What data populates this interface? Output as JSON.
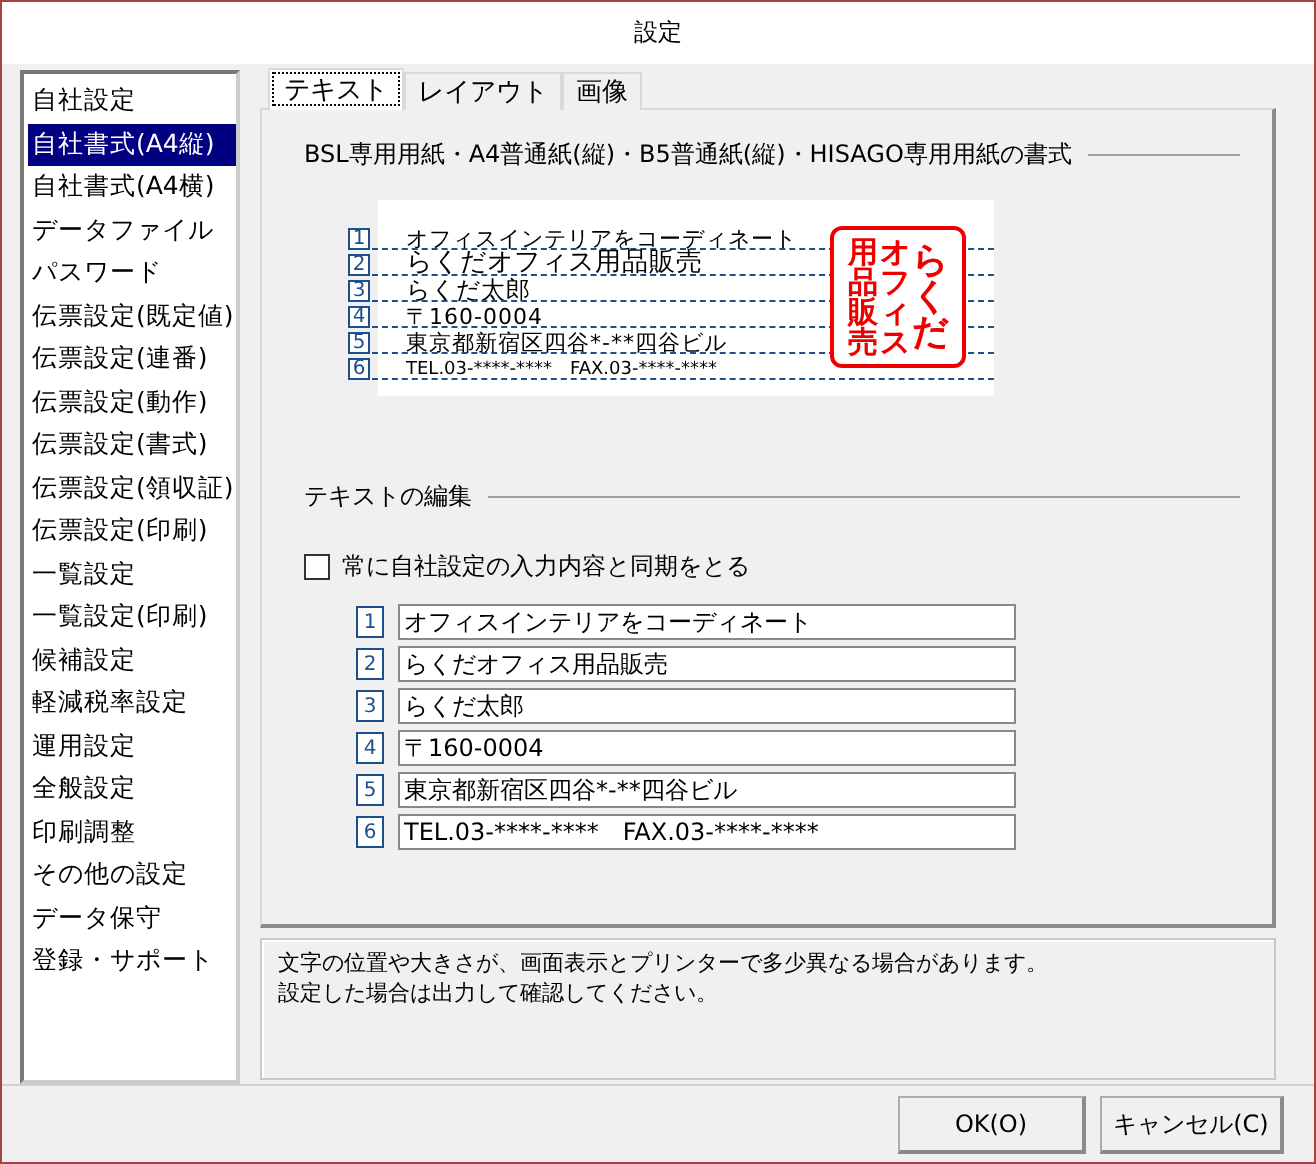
{
  "window": {
    "title": "設定"
  },
  "sidebar": {
    "items": [
      {
        "label": "自社設定",
        "selected": false
      },
      {
        "label": "自社書式(A4縦)",
        "selected": true
      },
      {
        "label": "自社書式(A4横)",
        "selected": false
      },
      {
        "label": "データファイル",
        "selected": false
      },
      {
        "label": "パスワード",
        "selected": false
      },
      {
        "label": "伝票設定(既定値)",
        "selected": false
      },
      {
        "label": "伝票設定(連番)",
        "selected": false
      },
      {
        "label": "伝票設定(動作)",
        "selected": false
      },
      {
        "label": "伝票設定(書式)",
        "selected": false
      },
      {
        "label": "伝票設定(領収証)",
        "selected": false
      },
      {
        "label": "伝票設定(印刷)",
        "selected": false
      },
      {
        "label": "一覧設定",
        "selected": false
      },
      {
        "label": "一覧設定(印刷)",
        "selected": false
      },
      {
        "label": "候補設定",
        "selected": false
      },
      {
        "label": "軽減税率設定",
        "selected": false
      },
      {
        "label": "運用設定",
        "selected": false
      },
      {
        "label": "全般設定",
        "selected": false
      },
      {
        "label": "印刷調整",
        "selected": false
      },
      {
        "label": "その他の設定",
        "selected": false
      },
      {
        "label": "データ保守",
        "selected": false
      },
      {
        "label": "登録・サポート",
        "selected": false
      }
    ]
  },
  "tabs": [
    {
      "label": "テキスト",
      "selected": true
    },
    {
      "label": "レイアウト",
      "selected": false
    },
    {
      "label": "画像",
      "selected": false
    }
  ],
  "preview": {
    "heading": "BSL専用用紙・A4普通紙(縦)・B5普通紙(縦)・HISAGO専用用紙の書式",
    "lines": [
      {
        "number": "1",
        "text": "オフィスインテリアをコーディネート"
      },
      {
        "number": "2",
        "text": "らくだオフィス用品販売"
      },
      {
        "number": "3",
        "text": "らくだ太郎"
      },
      {
        "number": "4",
        "text": "〒160-0004"
      },
      {
        "number": "5",
        "text": "東京都新宿区四谷*-**四谷ビル"
      },
      {
        "number": "6",
        "text": "TEL.03-****-****　FAX.03-****-****"
      }
    ],
    "stamp_columns": [
      "用品販売",
      "オフィス",
      "らくだ"
    ]
  },
  "editor": {
    "heading": "テキストの編集",
    "sync_checkbox": {
      "label": "常に自社設定の入力内容と同期をとる",
      "checked": false
    },
    "fields": [
      {
        "number": "1",
        "value": "オフィスインテリアをコーディネート"
      },
      {
        "number": "2",
        "value": "らくだオフィス用品販売"
      },
      {
        "number": "3",
        "value": "らくだ太郎"
      },
      {
        "number": "4",
        "value": "〒160-0004"
      },
      {
        "number": "5",
        "value": "東京都新宿区四谷*-**四谷ビル"
      },
      {
        "number": "6",
        "value": "TEL.03-****-****　FAX.03-****-****"
      }
    ]
  },
  "message": [
    "文字の位置や大きさが、画面表示とプリンターで多少異なる場合があります。",
    "設定した場合は出力して確認してください。"
  ],
  "buttons": [
    "OK(O)",
    "キャンセル(C)"
  ]
}
